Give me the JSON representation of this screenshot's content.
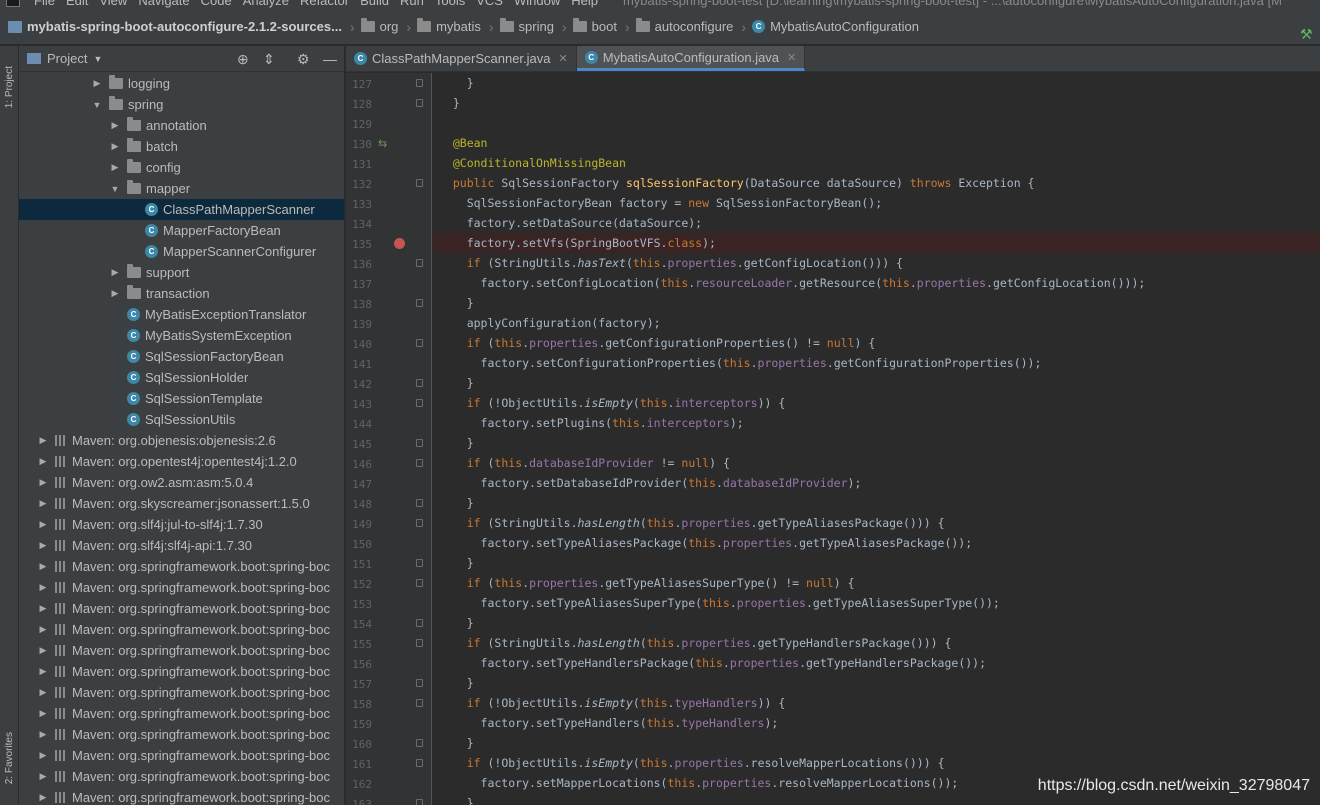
{
  "menu": {
    "items": [
      "File",
      "Edit",
      "View",
      "Navigate",
      "Code",
      "Analyze",
      "Refactor",
      "Build",
      "Run",
      "Tools",
      "VCS",
      "Window",
      "Help"
    ],
    "window_title": "mybatis-spring-boot-test [D:\\learning\\mybatis-spring-boot-test] - ...\\autoconfigure\\MybatisAutoConfiguration.java [M"
  },
  "breadcrumb": {
    "root": "mybatis-spring-boot-autoconfigure-2.1.2-sources...",
    "parts": [
      "org",
      "mybatis",
      "spring",
      "boot",
      "autoconfigure"
    ],
    "file": "MybatisAutoConfiguration"
  },
  "side_tabs": {
    "project": "1: Project",
    "favorites": "2: Favorites"
  },
  "project_panel": {
    "title": "Project"
  },
  "tree": [
    {
      "label": "logging",
      "type": "folder",
      "indent": 1,
      "arrow": "right"
    },
    {
      "label": "spring",
      "type": "folder",
      "indent": 1,
      "arrow": "down"
    },
    {
      "label": "annotation",
      "type": "folder",
      "indent": 2,
      "arrow": "right"
    },
    {
      "label": "batch",
      "type": "folder",
      "indent": 2,
      "arrow": "right"
    },
    {
      "label": "config",
      "type": "folder",
      "indent": 2,
      "arrow": "right"
    },
    {
      "label": "mapper",
      "type": "folder",
      "indent": 2,
      "arrow": "down"
    },
    {
      "label": "ClassPathMapperScanner",
      "type": "class",
      "indent": 3,
      "selected": true
    },
    {
      "label": "MapperFactoryBean",
      "type": "class",
      "indent": 3
    },
    {
      "label": "MapperScannerConfigurer",
      "type": "class",
      "indent": 3
    },
    {
      "label": "support",
      "type": "folder",
      "indent": 2,
      "arrow": "right"
    },
    {
      "label": "transaction",
      "type": "folder",
      "indent": 2,
      "arrow": "right"
    },
    {
      "label": "MyBatisExceptionTranslator",
      "type": "class",
      "indent": 2
    },
    {
      "label": "MyBatisSystemException",
      "type": "class",
      "indent": 2
    },
    {
      "label": "SqlSessionFactoryBean",
      "type": "class",
      "indent": 2
    },
    {
      "label": "SqlSessionHolder",
      "type": "class",
      "indent": 2
    },
    {
      "label": "SqlSessionTemplate",
      "type": "class",
      "indent": 2
    },
    {
      "label": "SqlSessionUtils",
      "type": "class",
      "indent": 2
    },
    {
      "label": "Maven: org.objenesis:objenesis:2.6",
      "type": "maven",
      "indent": 0,
      "arrow": "right"
    },
    {
      "label": "Maven: org.opentest4j:opentest4j:1.2.0",
      "type": "maven",
      "indent": 0,
      "arrow": "right"
    },
    {
      "label": "Maven: org.ow2.asm:asm:5.0.4",
      "type": "maven",
      "indent": 0,
      "arrow": "right"
    },
    {
      "label": "Maven: org.skyscreamer:jsonassert:1.5.0",
      "type": "maven",
      "indent": 0,
      "arrow": "right"
    },
    {
      "label": "Maven: org.slf4j:jul-to-slf4j:1.7.30",
      "type": "maven",
      "indent": 0,
      "arrow": "right"
    },
    {
      "label": "Maven: org.slf4j:slf4j-api:1.7.30",
      "type": "maven",
      "indent": 0,
      "arrow": "right"
    },
    {
      "label": "Maven: org.springframework.boot:spring-boc",
      "type": "maven",
      "indent": 0,
      "arrow": "right"
    },
    {
      "label": "Maven: org.springframework.boot:spring-boc",
      "type": "maven",
      "indent": 0,
      "arrow": "right"
    },
    {
      "label": "Maven: org.springframework.boot:spring-boc",
      "type": "maven",
      "indent": 0,
      "arrow": "right"
    },
    {
      "label": "Maven: org.springframework.boot:spring-boc",
      "type": "maven",
      "indent": 0,
      "arrow": "right"
    },
    {
      "label": "Maven: org.springframework.boot:spring-boc",
      "type": "maven",
      "indent": 0,
      "arrow": "right"
    },
    {
      "label": "Maven: org.springframework.boot:spring-boc",
      "type": "maven",
      "indent": 0,
      "arrow": "right"
    },
    {
      "label": "Maven: org.springframework.boot:spring-boc",
      "type": "maven",
      "indent": 0,
      "arrow": "right"
    },
    {
      "label": "Maven: org.springframework.boot:spring-boc",
      "type": "maven",
      "indent": 0,
      "arrow": "right"
    },
    {
      "label": "Maven: org.springframework.boot:spring-boc",
      "type": "maven",
      "indent": 0,
      "arrow": "right"
    },
    {
      "label": "Maven: org.springframework.boot:spring-boc",
      "type": "maven",
      "indent": 0,
      "arrow": "right"
    },
    {
      "label": "Maven: org.springframework.boot:spring-boc",
      "type": "maven",
      "indent": 0,
      "arrow": "right"
    },
    {
      "label": "Maven: org.springframework.boot:spring-boc",
      "type": "maven",
      "indent": 0,
      "arrow": "right"
    }
  ],
  "tabs": [
    {
      "label": "ClassPathMapperScanner.java",
      "active": false
    },
    {
      "label": "MybatisAutoConfiguration.java",
      "active": true
    }
  ],
  "code": [
    {
      "n": 127,
      "t": "    }"
    },
    {
      "n": 128,
      "t": "  }"
    },
    {
      "n": 129,
      "t": ""
    },
    {
      "n": 130,
      "t": "  @Bean",
      "gicon": true
    },
    {
      "n": 131,
      "t": "  @ConditionalOnMissingBean"
    },
    {
      "n": 132,
      "t": "  public SqlSessionFactory sqlSessionFactory(DataSource dataSource) throws Exception {"
    },
    {
      "n": 133,
      "t": "    SqlSessionFactoryBean factory = new SqlSessionFactoryBean();"
    },
    {
      "n": 134,
      "t": "    factory.setDataSource(dataSource);"
    },
    {
      "n": 135,
      "t": "    factory.setVfs(SpringBootVFS.class);",
      "bp": true
    },
    {
      "n": 136,
      "t": "    if (StringUtils.hasText(this.properties.getConfigLocation())) {"
    },
    {
      "n": 137,
      "t": "      factory.setConfigLocation(this.resourceLoader.getResource(this.properties.getConfigLocation()));"
    },
    {
      "n": 138,
      "t": "    }"
    },
    {
      "n": 139,
      "t": "    applyConfiguration(factory);"
    },
    {
      "n": 140,
      "t": "    if (this.properties.getConfigurationProperties() != null) {"
    },
    {
      "n": 141,
      "t": "      factory.setConfigurationProperties(this.properties.getConfigurationProperties());"
    },
    {
      "n": 142,
      "t": "    }"
    },
    {
      "n": 143,
      "t": "    if (!ObjectUtils.isEmpty(this.interceptors)) {"
    },
    {
      "n": 144,
      "t": "      factory.setPlugins(this.interceptors);"
    },
    {
      "n": 145,
      "t": "    }"
    },
    {
      "n": 146,
      "t": "    if (this.databaseIdProvider != null) {"
    },
    {
      "n": 147,
      "t": "      factory.setDatabaseIdProvider(this.databaseIdProvider);"
    },
    {
      "n": 148,
      "t": "    }"
    },
    {
      "n": 149,
      "t": "    if (StringUtils.hasLength(this.properties.getTypeAliasesPackage())) {"
    },
    {
      "n": 150,
      "t": "      factory.setTypeAliasesPackage(this.properties.getTypeAliasesPackage());"
    },
    {
      "n": 151,
      "t": "    }"
    },
    {
      "n": 152,
      "t": "    if (this.properties.getTypeAliasesSuperType() != null) {"
    },
    {
      "n": 153,
      "t": "      factory.setTypeAliasesSuperType(this.properties.getTypeAliasesSuperType());"
    },
    {
      "n": 154,
      "t": "    }"
    },
    {
      "n": 155,
      "t": "    if (StringUtils.hasLength(this.properties.getTypeHandlersPackage())) {"
    },
    {
      "n": 156,
      "t": "      factory.setTypeHandlersPackage(this.properties.getTypeHandlersPackage());"
    },
    {
      "n": 157,
      "t": "    }"
    },
    {
      "n": 158,
      "t": "    if (!ObjectUtils.isEmpty(this.typeHandlers)) {"
    },
    {
      "n": 159,
      "t": "      factory.setTypeHandlers(this.typeHandlers);"
    },
    {
      "n": 160,
      "t": "    }"
    },
    {
      "n": 161,
      "t": "    if (!ObjectUtils.isEmpty(this.properties.resolveMapperLocations())) {"
    },
    {
      "n": 162,
      "t": "      factory.setMapperLocations(this.properties.resolveMapperLocations());"
    },
    {
      "n": 163,
      "t": "    }"
    }
  ],
  "watermark": "https://blog.csdn.net/weixin_32798047",
  "colors": {
    "keyword": "#cc7832",
    "annotation": "#bbb529",
    "method": "#ffc66d",
    "field": "#9876aa",
    "text": "#a9b7c6",
    "selection": "#0d293e",
    "breakpoint": "#c75450"
  }
}
